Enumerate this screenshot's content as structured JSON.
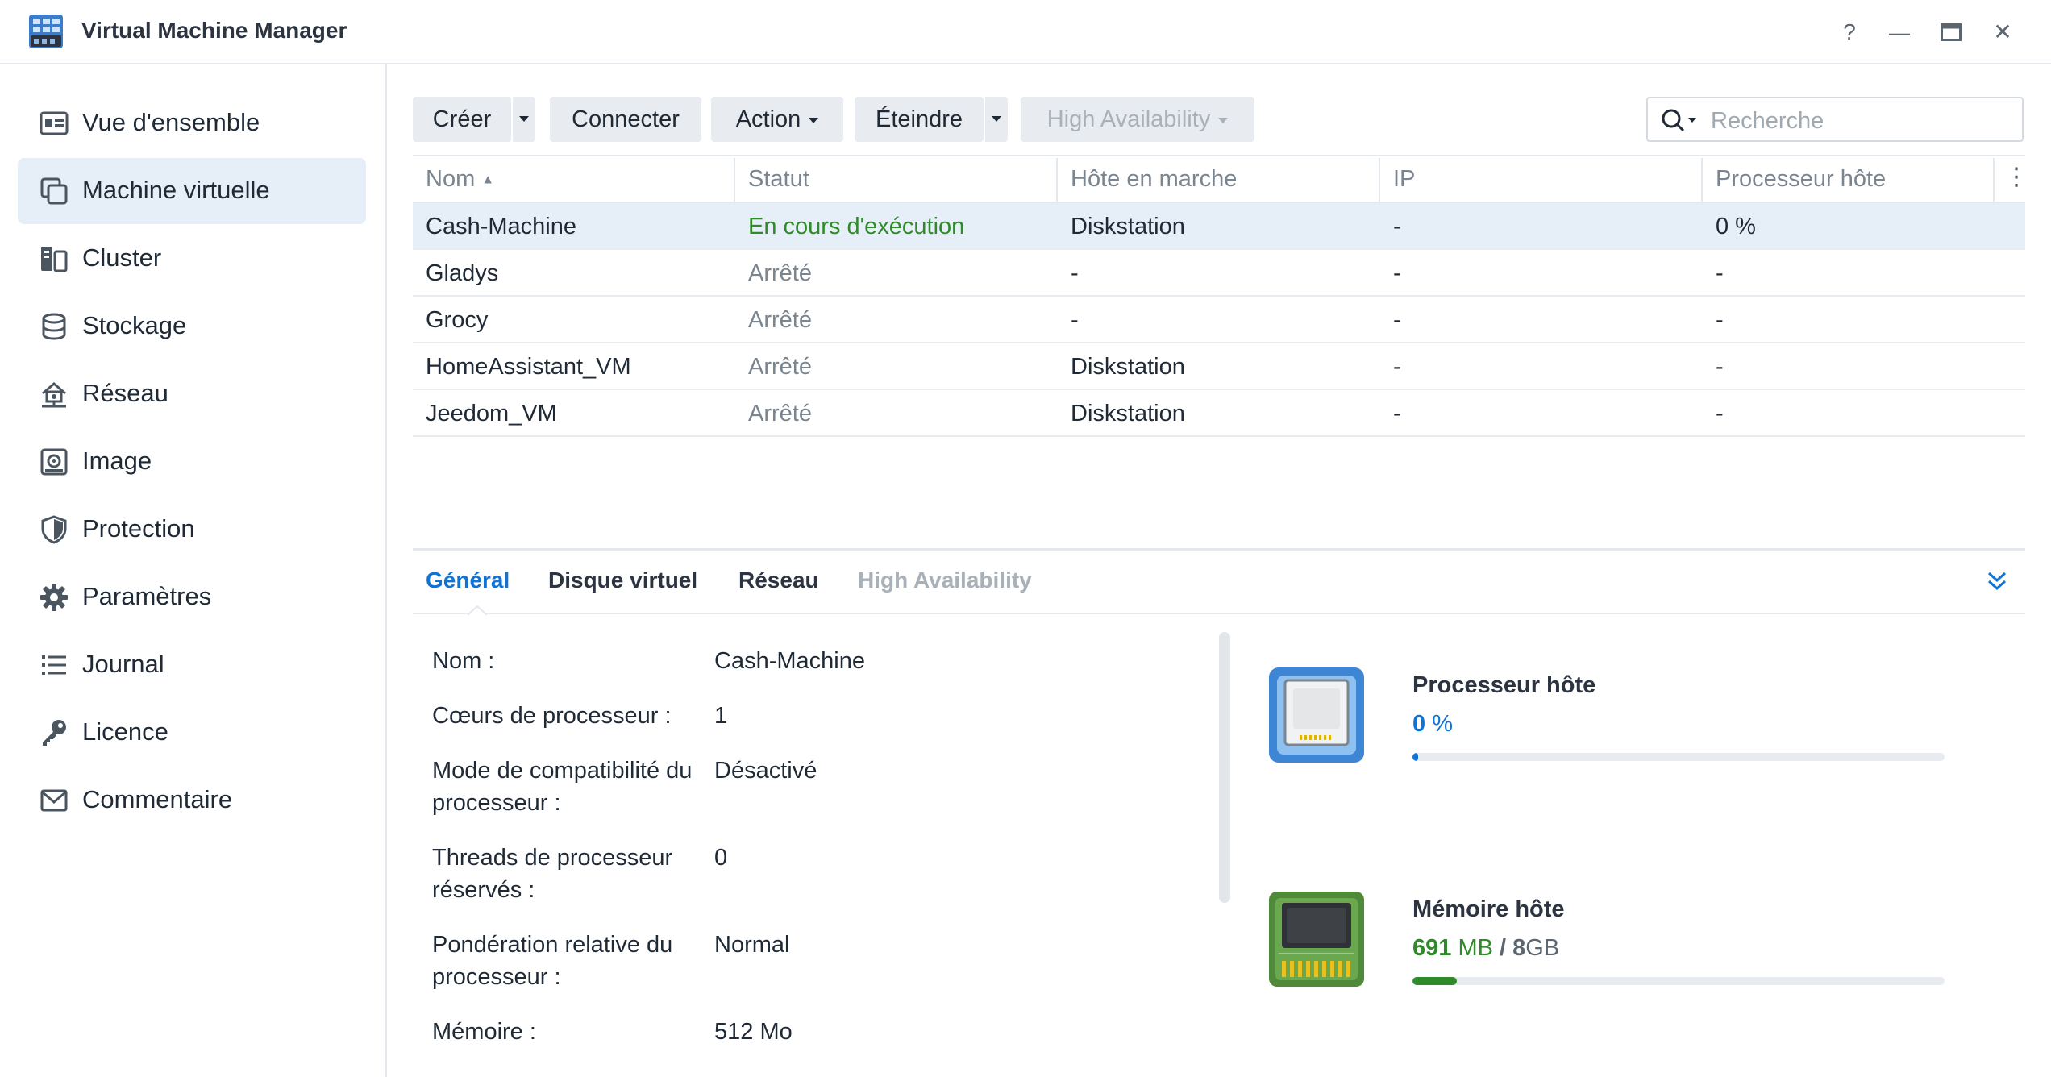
{
  "window": {
    "title": "Virtual Machine Manager",
    "help_icon": "?",
    "minimize_icon": "—",
    "maximize_icon": "▭",
    "close_icon": "✕"
  },
  "sidebar": {
    "items": [
      {
        "label": "Vue d'ensemble",
        "icon": "overview-icon",
        "active": false
      },
      {
        "label": "Machine virtuelle",
        "icon": "virtual-machine-icon",
        "active": true
      },
      {
        "label": "Cluster",
        "icon": "cluster-icon",
        "active": false
      },
      {
        "label": "Stockage",
        "icon": "storage-icon",
        "active": false
      },
      {
        "label": "Réseau",
        "icon": "network-icon",
        "active": false
      },
      {
        "label": "Image",
        "icon": "image-icon",
        "active": false
      },
      {
        "label": "Protection",
        "icon": "shield-icon",
        "active": false
      },
      {
        "label": "Paramètres",
        "icon": "gear-icon",
        "active": false
      },
      {
        "label": "Journal",
        "icon": "list-icon",
        "active": false
      },
      {
        "label": "Licence",
        "icon": "key-icon",
        "active": false
      },
      {
        "label": "Commentaire",
        "icon": "mail-icon",
        "active": false
      }
    ]
  },
  "toolbar": {
    "create_label": "Créer",
    "connect_label": "Connecter",
    "action_label": "Action",
    "shutdown_label": "Éteindre",
    "ha_label": "High Availability",
    "search_placeholder": "Recherche"
  },
  "table": {
    "headers": [
      "Nom",
      "Statut",
      "Hôte en marche",
      "IP",
      "Processeur hôte"
    ],
    "rows": [
      {
        "name": "Cash-Machine",
        "status": "En cours d'exécution",
        "host": "Diskstation",
        "ip": "-",
        "cpu": "0 %",
        "selected": true
      },
      {
        "name": "Gladys",
        "status": "Arrêté",
        "host": "-",
        "ip": "-",
        "cpu": "-",
        "selected": false
      },
      {
        "name": "Grocy",
        "status": "Arrêté",
        "host": "-",
        "ip": "-",
        "cpu": "-",
        "selected": false
      },
      {
        "name": "HomeAssistant_VM",
        "status": "Arrêté",
        "host": "Diskstation",
        "ip": "-",
        "cpu": "-",
        "selected": false
      },
      {
        "name": "Jeedom_VM",
        "status": "Arrêté",
        "host": "Diskstation",
        "ip": "-",
        "cpu": "-",
        "selected": false
      }
    ]
  },
  "detail": {
    "tabs": [
      "Général",
      "Disque virtuel",
      "Réseau",
      "High Availability"
    ],
    "fields": [
      {
        "label": "Nom :",
        "value": "Cash-Machine"
      },
      {
        "label": "Cœurs de processeur :",
        "value": "1"
      },
      {
        "label": "Mode de compatibilité du processeur :",
        "value": "Désactivé"
      },
      {
        "label": "Threads de processeur réservés :",
        "value": "0"
      },
      {
        "label": "Pondération relative du processeur :",
        "value": "Normal"
      },
      {
        "label": "Mémoire :",
        "value": "512 Mo"
      }
    ],
    "cpu": {
      "title": "Processeur hôte",
      "value": "0",
      "unit": "%",
      "percent": 1,
      "color": "#1273d6"
    },
    "memory": {
      "title": "Mémoire hôte",
      "used": "691",
      "used_unit": "MB",
      "separator": "/",
      "total": "8",
      "total_unit": "GB",
      "percent": 8.4,
      "color": "#2f8a2a"
    }
  }
}
